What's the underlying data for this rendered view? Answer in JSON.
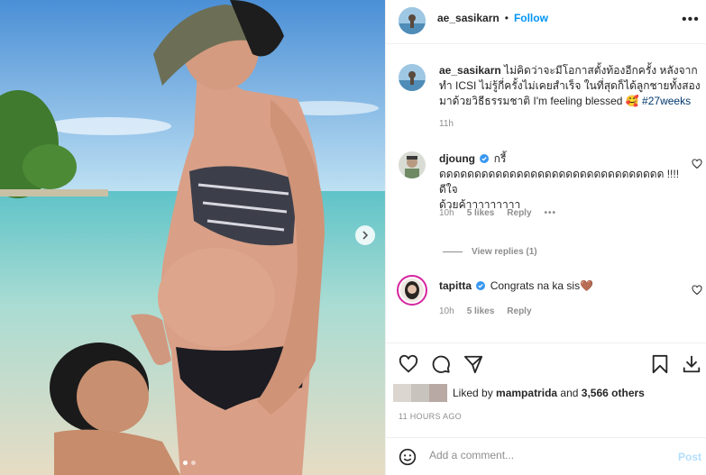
{
  "post": {
    "author": "ae_sasikarn",
    "follow_label": "Follow",
    "separator": "•",
    "more_label": "•••"
  },
  "caption": {
    "author": "ae_sasikarn",
    "line1": "ไม่คิดว่าจะมีโอกาสตั้งท้องอีกครั้ง หลังจาก",
    "line2": "ทำ ICSI ไม่รู้กี่ครั้งไม่เคยสำเร็จ ในที่สุดก็ได้ลูกชายทั้งสอง",
    "line3": "มาด้วยวิธีธรรมชาติ I'm feeling blessed 🥰",
    "hashtag": "#27weeks",
    "time": "11h"
  },
  "comments": [
    {
      "author": "djoung",
      "text1": "กรี้",
      "text2": "ดดดดดดดดดดดดดดดดดดดดดดดดดดดดดดดด !!!! ดีใจ",
      "text3": "ด้วยค้าาาาาาาาา",
      "time": "10h",
      "likes": "5 likes",
      "reply": "Reply",
      "more": "•••",
      "view_replies": "View replies (1)"
    },
    {
      "author": "tapitta",
      "text1": "Congrats na ka sis🤎",
      "time": "10h",
      "likes": "5 likes",
      "reply": "Reply"
    }
  ],
  "likes": {
    "prefix": "Liked by",
    "user": "mampatrida",
    "and": "and",
    "others": "3,566 others"
  },
  "timestamp": "11 HOURS AGO",
  "comment_box": {
    "placeholder": "Add a comment...",
    "post_label": "Post"
  },
  "icons": {
    "like": "heart-icon",
    "comment": "comment-icon",
    "share": "send-icon",
    "save": "bookmark-icon",
    "download": "download-icon",
    "emoji": "emoji-icon",
    "next": "chevron-right-icon"
  },
  "colors": {
    "accent": "#0095f6",
    "muted": "#8e8e8e",
    "text": "#262626",
    "verified": "#3897f0"
  }
}
